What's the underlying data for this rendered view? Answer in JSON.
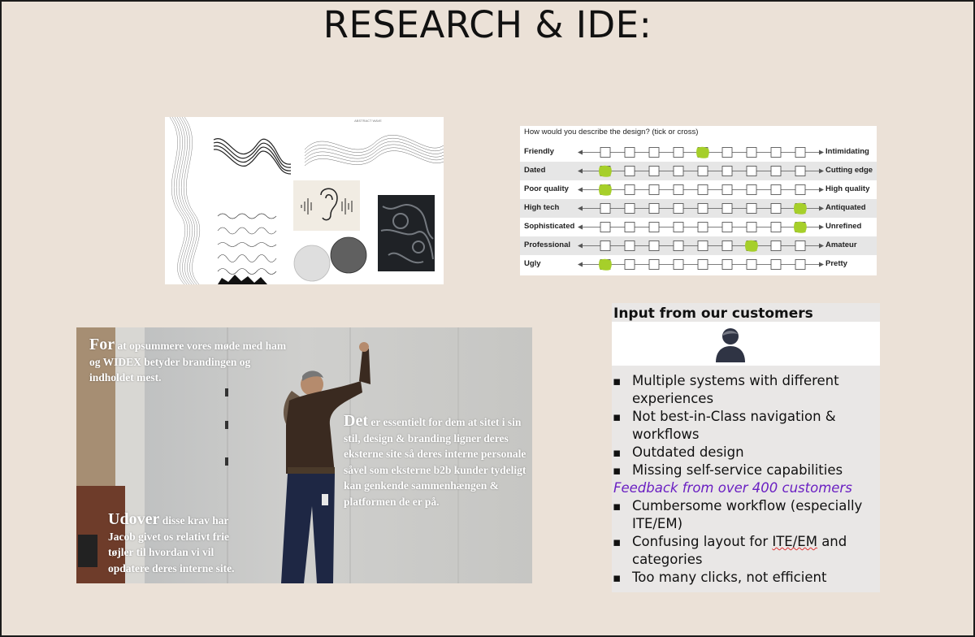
{
  "title": "RESEARCH & IDE:",
  "moodboard": {
    "caption": "ABSTRACT WAVE"
  },
  "survey": {
    "question": "How would you describe the design? (tick or cross)",
    "accent_color": "#a6cf2a",
    "rows": [
      {
        "left": "Friendly",
        "right": "Intimidating",
        "selected": 5
      },
      {
        "left": "Dated",
        "right": "Cutting edge",
        "selected": 1
      },
      {
        "left": "Poor quality",
        "right": "High quality",
        "selected": 1
      },
      {
        "left": "High tech",
        "right": "Antiquated",
        "selected": 9
      },
      {
        "left": "Sophisticated",
        "right": "Unrefined",
        "selected": 9
      },
      {
        "left": "Professional",
        "right": "Amateur",
        "selected": 7
      },
      {
        "left": "Ugly",
        "right": "Pretty",
        "selected": 1
      }
    ]
  },
  "photo": {
    "p1_lead": "For",
    "p1_rest": " at opsummere vores møde med ham og WIDEX betyder brandingen og indholdet mest.",
    "p2_lead": "Det",
    "p2_rest": " er essentielt for dem at sitet i sin stil, design & branding ligner deres eksterne site så deres interne personale såvel som eksterne b2b kunder tydeligt kan genkende sammenhængen & platformen de er på.",
    "p3_lead": "Udover",
    "p3_rest": " disse krav har Jacob givet os relativt frie tøjler til hvordan vi vil opdatere deres interne site."
  },
  "customers": {
    "heading": "Input from our customers",
    "items": [
      "Multiple systems with different experiences",
      "Not best-in-Class navigation & workflows",
      "Outdated design",
      "Missing self-service capabilities"
    ],
    "feedback": "Feedback from over 400 customers",
    "items2": [
      "Cumbersome workflow (especially ITE/EM)",
      "Confusing layout for ITE/EM and categories",
      "Too many clicks, not efficient"
    ]
  }
}
